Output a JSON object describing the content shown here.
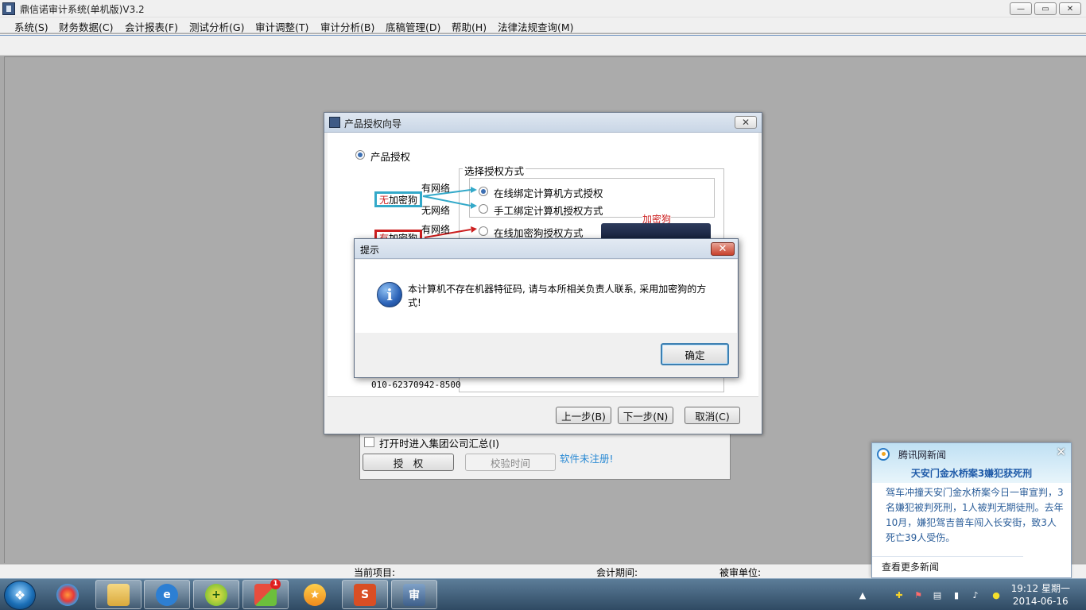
{
  "app": {
    "title": "鼎信诺审计系统(单机版)V3.2",
    "controls": [
      "—",
      "▭",
      "✕"
    ]
  },
  "menu": [
    "系统(S)",
    "财务数据(C)",
    "会计报表(F)",
    "测试分析(G)",
    "审计调整(T)",
    "审计分析(B)",
    "底稿管理(D)",
    "帮助(H)",
    "法律法规查询(M)"
  ],
  "status": {
    "project_label": "当前项目:",
    "period_label": "会计期间:",
    "audited_label": "被审单位:"
  },
  "bg_panel": {
    "checkbox_label": "打开时进入集团公司汇总(I)",
    "authorize_button": "授　权",
    "verify_time_button": "校验时间",
    "unregistered_link": "软件未注册!"
  },
  "wizard": {
    "title": "产品授权向导",
    "product_auth_label": "产品授权",
    "group_title": "选择授权方式",
    "no_dongle_tag_prefix": "无",
    "no_dongle_tag_suffix": "加密狗",
    "has_dongle_tag_prefix": "有",
    "has_dongle_tag_suffix": "加密狗",
    "net_yes_1": "有网络",
    "net_no": "无网络",
    "net_yes_2": "有网络",
    "opt_online_bind": "在线绑定计算机方式授权",
    "opt_manual_bind": "手工绑定计算机授权方式",
    "opt_online_dongle": "在线加密狗授权方式",
    "dongle_caption": "加密狗",
    "phone": "010-62370942-8500",
    "prev_button": "上一步(B)",
    "next_button": "下一步(N)",
    "cancel_button": "取消(C)"
  },
  "message": {
    "title": "提示",
    "text": "本计算机不存在机器特征码, 请与本所相关负责人联系, 采用加密狗的方式!",
    "ok_button": "确定"
  },
  "news": {
    "source": "腾讯网新闻",
    "headline": "天安门金水桥案3嫌犯获死刑",
    "body": "驾车冲撞天安门金水桥案今日一审宣判，3名嫌犯被判死刑，1人被判无期徒刑。去年10月，嫌犯驾吉普车闯入长安街，致3人死亡39人受伤。",
    "more": "查看更多新闻"
  },
  "taskbar": {
    "badge": "1",
    "kingsoft_label": "S",
    "audit_label": "审",
    "clock_time": "19:12 星期一",
    "clock_date": "2014-06-16"
  },
  "colors": {
    "tag_cyan": "#33a9c9",
    "tag_red": "#cc1f1f",
    "link_blue": "#2a8ad4"
  }
}
